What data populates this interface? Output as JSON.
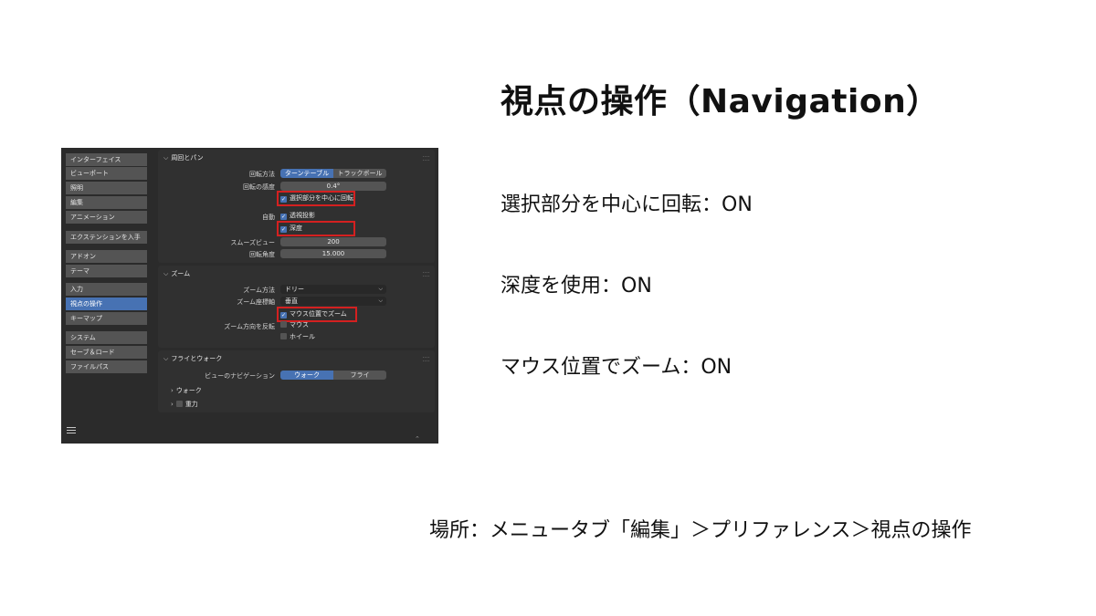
{
  "slide": {
    "title": "視点の操作（Navigation）",
    "notes": [
      "選択部分を中心に回転：ON",
      "深度を使用：ON",
      "マウス位置でズーム：ON"
    ],
    "location": "場所：メニュータブ「編集」＞プリファレンス＞視点の操作"
  },
  "sidebar": {
    "items": [
      "インターフェイス",
      "ビューポート",
      "照明",
      "編集",
      "アニメーション",
      "エクステンションを入手",
      "アドオン",
      "テーマ",
      "入力",
      "視点の操作",
      "キーマップ",
      "システム",
      "セーブ＆ロード",
      "ファイルパス"
    ],
    "active": "視点の操作"
  },
  "orbit": {
    "header": "周回とパン",
    "method_label": "回転方法",
    "method_options": [
      "ターンテーブル",
      "トラックボール"
    ],
    "method_selected": "ターンテーブル",
    "sensitivity_label": "回転の感度",
    "sensitivity_value": "0.4°",
    "orbit_selection_label": "選択部分を中心に回転",
    "orbit_selection": true,
    "auto_label": "自動",
    "auto_perspective_label": "透視投影",
    "auto_perspective": true,
    "auto_depth_label": "深度",
    "auto_depth": true,
    "smooth_view_label": "スムーズビュー",
    "smooth_view_value": "200",
    "rotation_angle_label": "回転角度",
    "rotation_angle_value": "15.000"
  },
  "zoom": {
    "header": "ズーム",
    "method_label": "ズーム方法",
    "method_value": "ドリー",
    "axis_label": "ズーム座標軸",
    "axis_value": "垂直",
    "zoom_to_mouse_label": "マウス位置でズーム",
    "zoom_to_mouse": true,
    "invert_label": "ズーム方向を反転",
    "invert_mouse_label": "マウス",
    "invert_mouse": false,
    "invert_wheel_label": "ホイール",
    "invert_wheel": false
  },
  "fly_walk": {
    "header": "フライとウォーク",
    "nav_label": "ビューのナビゲーション",
    "nav_options": [
      "ウォーク",
      "フライ"
    ],
    "nav_selected": "ウォーク",
    "walk_label": "ウォーク",
    "gravity_label": "重力",
    "gravity": false
  },
  "colors": {
    "accent": "#4772b3",
    "highlight": "#d42020",
    "panel_bg": "#2b2b2b",
    "section_bg": "#303030"
  },
  "icons": [
    "checkmark-icon",
    "chevron-down-icon",
    "chevron-right-icon",
    "hamburger-menu-icon",
    "grip-icon"
  ]
}
